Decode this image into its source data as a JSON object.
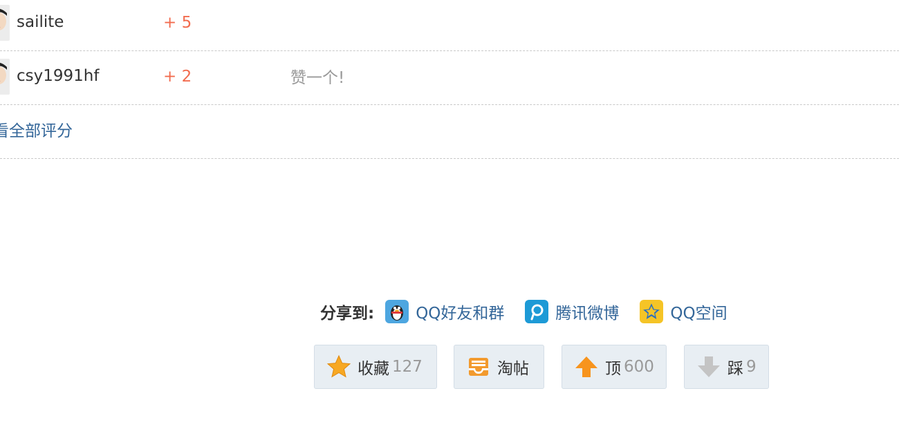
{
  "ratings": [
    {
      "user": "sailite",
      "score": "+ 5",
      "reason": ""
    },
    {
      "user": "csy1991hf",
      "score": "+ 2",
      "reason": "赞一个!"
    }
  ],
  "view_all_label": "看全部评分",
  "share": {
    "label": "分享到:",
    "targets": [
      {
        "label": "QQ好友和群",
        "icon": "qq-penguin-icon"
      },
      {
        "label": "腾讯微博",
        "icon": "tencent-weibo-icon"
      },
      {
        "label": "QQ空间",
        "icon": "qzone-star-icon"
      }
    ]
  },
  "actions": {
    "favorite": {
      "label": "收藏",
      "count": "127",
      "icon": "star-icon"
    },
    "taotie": {
      "label": "淘帖",
      "icon": "tray-icon"
    },
    "upvote": {
      "label": "顶",
      "count": "600",
      "icon": "arrow-up-icon"
    },
    "downvote": {
      "label": "踩",
      "count": "9",
      "icon": "arrow-down-icon"
    }
  },
  "colors": {
    "link": "#336699",
    "score": "#f26c4f",
    "button_bg": "#e8eef3"
  }
}
